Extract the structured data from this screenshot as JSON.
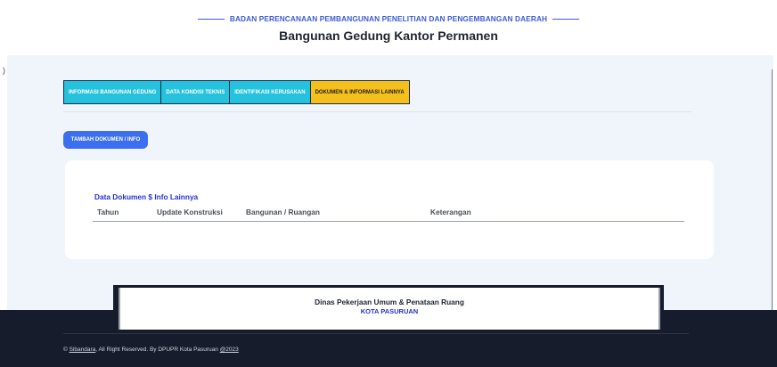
{
  "header": {
    "subtitle": "BADAN PERENCANAAN PEMBANGUNAN PENELITIAN DAN PENGEMBANGAN DAERAH",
    "title": "Bangunan Gedung Kantor Permanen"
  },
  "edge_mark": ")",
  "tabs": [
    {
      "label": "INFORMASI BANGUNAN GEDUNG"
    },
    {
      "label": "DATA KONDISI TEKNIS"
    },
    {
      "label": "IDENTIFIKASI KERUSAKAN"
    },
    {
      "label": "DOKUMEN & INFORMASI LAINNYA"
    }
  ],
  "actions": {
    "add_label": "TAMBAH DOKUMEN / INFO"
  },
  "documents": {
    "title": "Data Dokumen $ Info Lainnya",
    "columns": [
      "Tahun",
      "Update Konstruksi",
      "Bangunan / Ruangan",
      "Keterangan"
    ]
  },
  "footer": {
    "org_name": "Dinas Pekerjaan Umum & Penataan Ruang",
    "org_city": "KOTA PASURUAN",
    "copyright_prefix": "© ",
    "brand": "Sibandara",
    "copyright_mid": ", All Right Reserved. By DPUPR Kota Pasuruan ",
    "year": "@2023"
  },
  "colors": {
    "accent": "#3b6ff0",
    "tab_cyan": "#25c1dd",
    "tab_active": "#f5c01b",
    "footer_bg": "#161c2c"
  }
}
